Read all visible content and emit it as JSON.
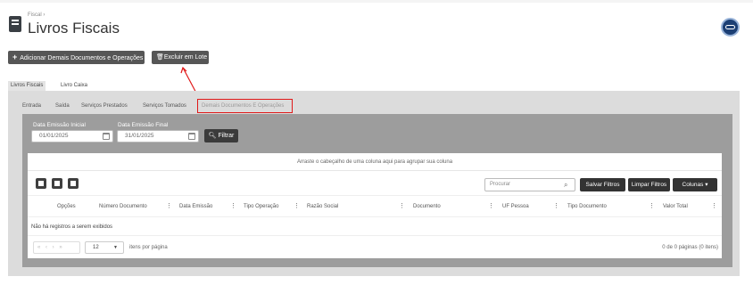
{
  "breadcrumb": "Fiscal  ›",
  "page_title": "Livros Fiscais",
  "avatar_label": "●●",
  "toolbar": {
    "add_label": "Adicionar Demais Documentos e Operações",
    "add_icon": "plus-icon",
    "delete_label": "Excluir em Lote",
    "delete_icon": "trash-icon"
  },
  "main_tabs": [
    {
      "label": "Livros Fiscais",
      "active": true
    },
    {
      "label": "Livro Caixa",
      "active": false
    }
  ],
  "sub_tabs": [
    {
      "label": "Entrada"
    },
    {
      "label": "Saída"
    },
    {
      "label": "Serviços Prestados"
    },
    {
      "label": "Serviços Tomados"
    },
    {
      "label": "Demais Documentos E Operações",
      "active": true
    }
  ],
  "filters": {
    "start_label": "Data Emissão Inicial",
    "start_value": "01/01/2025",
    "end_label": "Data Emissão Final",
    "end_value": "31/01/2025",
    "filter_button": "Filtrar",
    "filter_icon": "search-icon"
  },
  "grid": {
    "group_hint": "Arraste o cabeçalho de uma coluna aqui para agrupar sua coluna",
    "search_placeholder": "Procurar",
    "save_filters": "Salvar Filtros",
    "clear_filters": "Limpar Filtros",
    "columns_button": "Colunas",
    "columns": [
      "Opções",
      "Número Documento",
      "Data Emissão",
      "Tipo Operação",
      "Razão Social",
      "Documento",
      "UF Pessoa",
      "Tipo Documento",
      "Valor Total"
    ],
    "empty_message": "Não há registros a serem exibidos",
    "pager": {
      "nav": "« ‹ › »",
      "page_size": "12",
      "items_per_page": "itens por página",
      "info": "0 de 0 páginas (0 itens)"
    }
  }
}
